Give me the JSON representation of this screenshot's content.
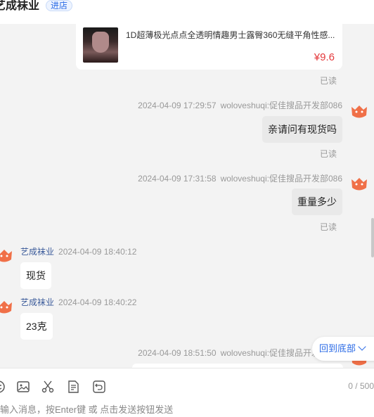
{
  "header": {
    "shop_name": "艺成袜业",
    "enter_shop": "进店"
  },
  "product": {
    "title": "1D超薄极光点点全透明情趣男士露臀360无缝平角性感...",
    "price": "¥9.6",
    "read_status": "已读"
  },
  "messages": [
    {
      "side": "right",
      "time": "2024-04-09 17:29:57",
      "nick": "woloveshuqi:促佳搜品开发部086",
      "text": "亲请问有现货吗",
      "read": "已读"
    },
    {
      "side": "right",
      "time": "2024-04-09 17:31:58",
      "nick": "woloveshuqi:促佳搜品开发部086",
      "text": "重量多少",
      "read": "已读"
    },
    {
      "side": "left",
      "nick": "艺成袜业",
      "time": "2024-04-09 18:40:12",
      "text": "现货"
    },
    {
      "side": "left",
      "nick": "艺成袜业",
      "time": "2024-04-09 18:40:22",
      "text": "23克"
    },
    {
      "side": "right",
      "time": "2024-04-09 18:51:50",
      "nick": "woloveshuqi:促佳搜品开发部086"
    }
  ],
  "back_to_bottom": "回到底部",
  "composer": {
    "counter": "0 / 500",
    "placeholder": "输入消息，按Enter键 或 点击发送按钮发送",
    "tools": [
      "emoji-icon",
      "image-icon",
      "scissors-icon",
      "order-icon",
      "recall-icon"
    ]
  },
  "colors": {
    "accent": "#2a6ae6",
    "price": "#e4393c",
    "avatar": "#f07048"
  }
}
